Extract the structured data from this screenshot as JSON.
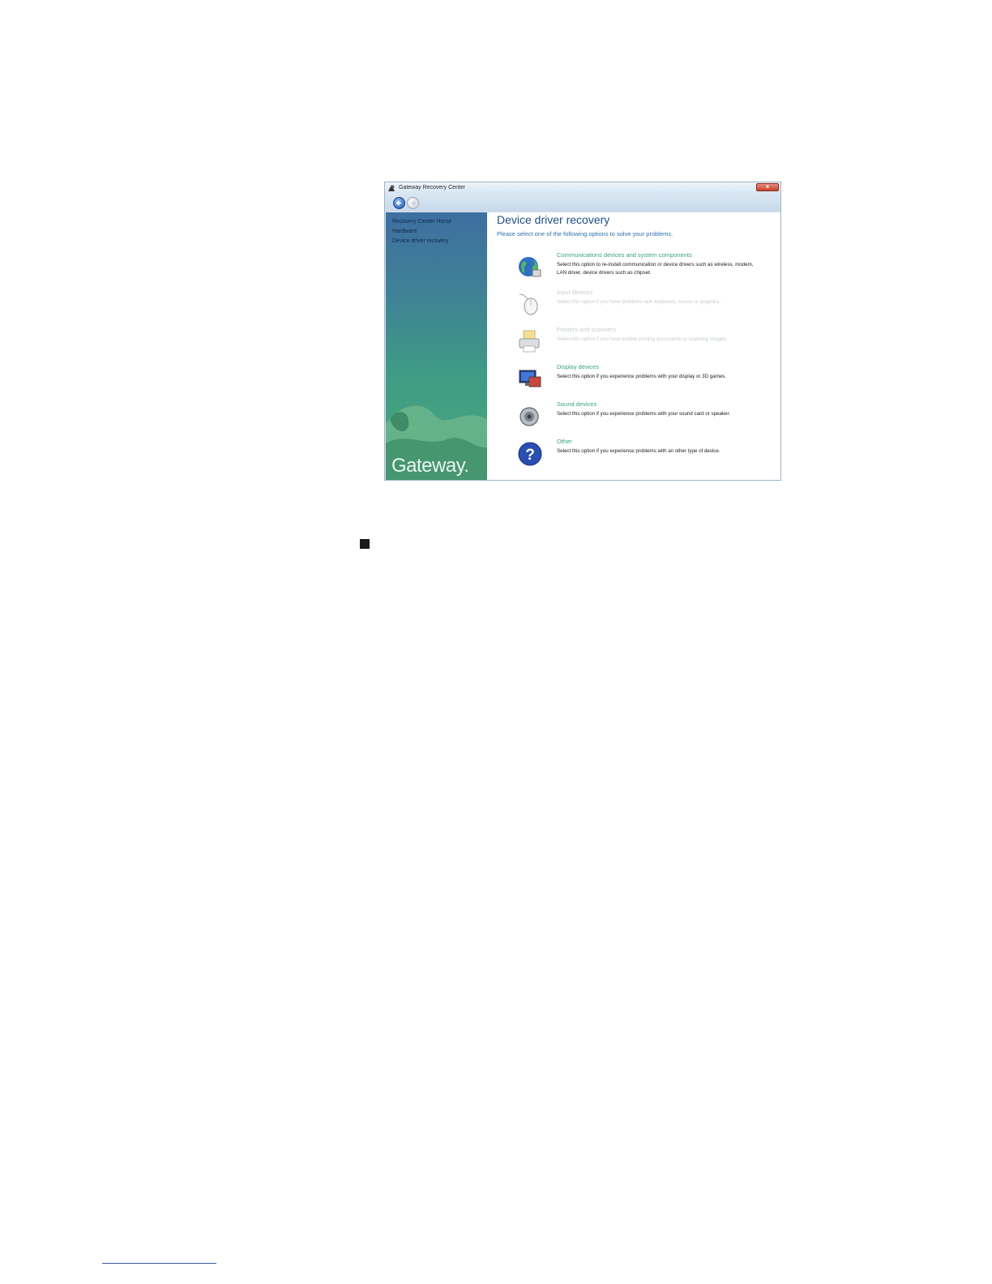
{
  "window": {
    "title": "Gateway Recovery Center",
    "close_label": "x",
    "brand": "Gateway."
  },
  "sidebar": {
    "items": [
      {
        "label": "Recovery Center Home"
      },
      {
        "label": "Hardware"
      },
      {
        "label": "Device driver recovery"
      }
    ]
  },
  "main": {
    "title": "Device driver recovery",
    "subtitle": "Please select one of the following options to solve your problems.",
    "options": [
      {
        "title": "Communications devices and system components",
        "description": "Select this option to re-install communication or device drivers such as wireless, modem, LAN driver, device drivers such as chipset.",
        "icon": "globe-network-icon",
        "enabled": true
      },
      {
        "title": "Input devices",
        "description": "Select this option if you have problems with keyboard, mouse or graphics.",
        "icon": "mouse-icon",
        "enabled": false
      },
      {
        "title": "Printers and scanners",
        "description": "Select this option if you have trouble printing documents or scanning images.",
        "icon": "printer-icon",
        "enabled": false
      },
      {
        "title": "Display devices",
        "description": "Select this option if you experience problems with your display or 3D games.",
        "icon": "display-icon",
        "enabled": true
      },
      {
        "title": "Sound devices",
        "description": "Select this option if you experience problems with your sound card or speaker.",
        "icon": "speaker-icon",
        "enabled": true
      },
      {
        "title": "Other",
        "description": "Select this option if you experience problems with an other type of device.",
        "icon": "question-icon",
        "enabled": true
      }
    ]
  },
  "colors": {
    "accent_title": "#1f4e8a",
    "option_link": "#37a57a",
    "sidebar_top": "#3e6fa0",
    "sidebar_bottom": "#4aa87a"
  }
}
